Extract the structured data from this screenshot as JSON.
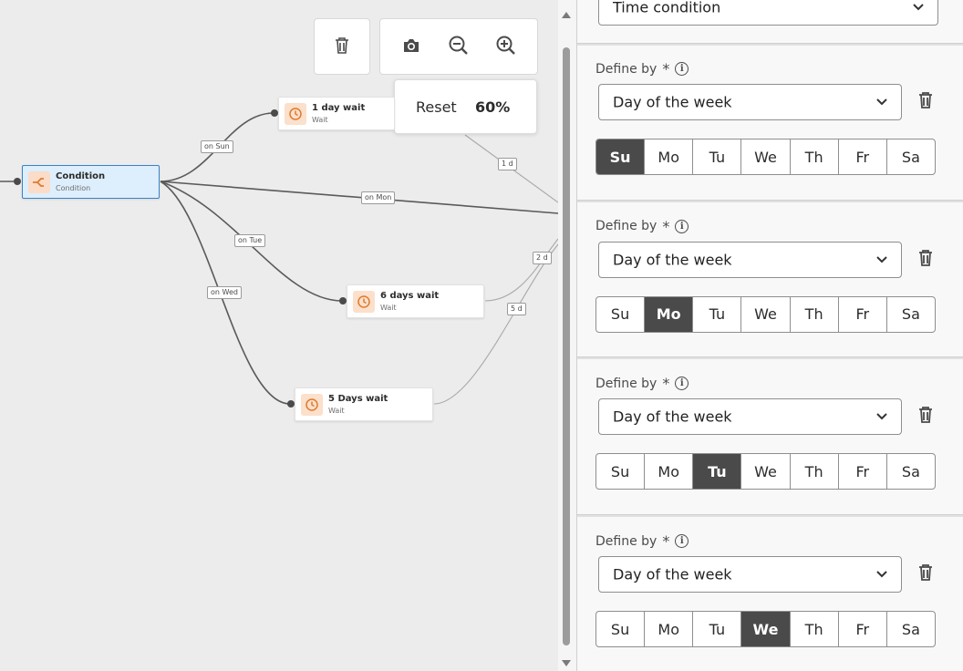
{
  "canvas": {
    "zoom": {
      "reset_label": "Reset",
      "level": "60%"
    },
    "toolbar": {
      "delete_icon": "trash-icon",
      "screenshot_icon": "camera-icon",
      "zoom_out_icon": "zoom-out-icon",
      "zoom_in_icon": "zoom-in-icon"
    },
    "nodes": {
      "condition": {
        "title": "Condition",
        "subtitle": "Condition",
        "icon": "condition-split-icon"
      },
      "wait_1d": {
        "title": "1 day wait",
        "subtitle": "Wait",
        "icon": "clock-icon"
      },
      "wait_6d": {
        "title": "6 days wait",
        "subtitle": "Wait",
        "icon": "clock-icon"
      },
      "wait_5d": {
        "title": "5 Days wait",
        "subtitle": "Wait",
        "icon": "clock-icon"
      }
    },
    "edge_labels": {
      "on_sun": "on Sun",
      "on_mon": "on Mon",
      "on_tue": "on Tue",
      "on_wed": "on Wed",
      "d1": "1 d",
      "d2": "2 d",
      "d5": "5 d"
    }
  },
  "panel": {
    "top_select_value": "Time condition",
    "define_label": "Define by",
    "required_mark": "*",
    "days": [
      "Su",
      "Mo",
      "Tu",
      "We",
      "Th",
      "Fr",
      "Sa"
    ],
    "conditions": [
      {
        "select_value": "Day of the week",
        "selected_day": "Su"
      },
      {
        "select_value": "Day of the week",
        "selected_day": "Mo"
      },
      {
        "select_value": "Day of the week",
        "selected_day": "Tu"
      },
      {
        "select_value": "Day of the week",
        "selected_day": "We"
      }
    ]
  },
  "colors": {
    "selected_day_bg": "#4a4a4a",
    "condition_node_bg": "#ddeefc",
    "condition_node_border": "#3b82c4",
    "node_icon_bg": "#fbe0cc",
    "node_icon_fg": "#e07b2c"
  }
}
